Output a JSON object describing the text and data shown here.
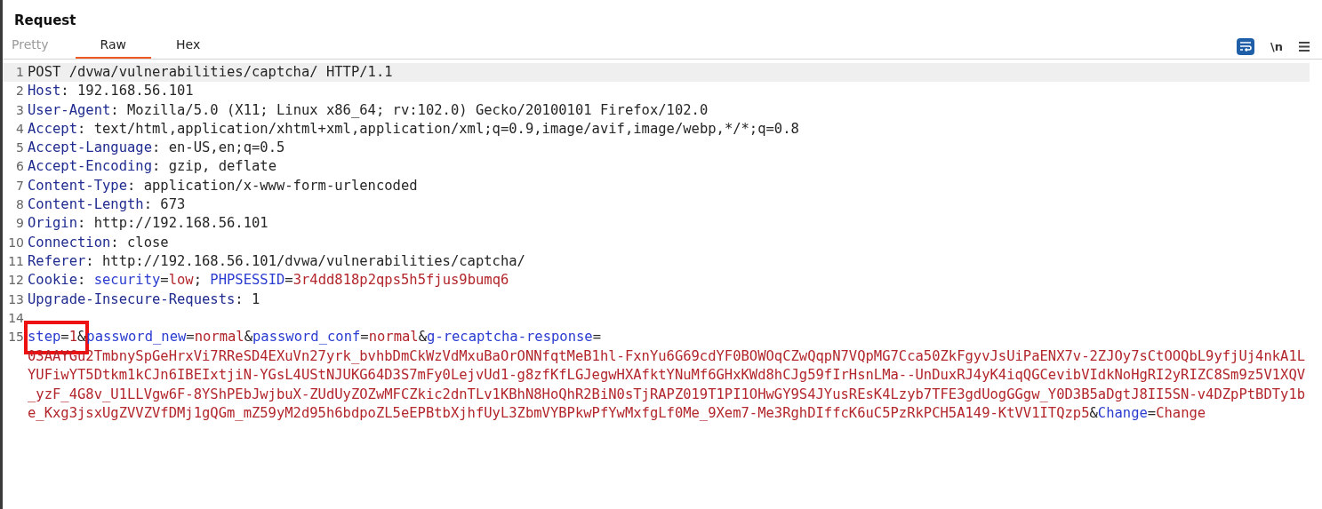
{
  "panel": {
    "title": "Request"
  },
  "tabs": [
    {
      "label": "Pretty",
      "selected": false,
      "disabled": true
    },
    {
      "label": "Raw",
      "selected": true,
      "disabled": false
    },
    {
      "label": "Hex",
      "selected": false,
      "disabled": false
    }
  ],
  "toolbar": {
    "wrap_lines": {
      "on": true
    },
    "newline_toggle": {
      "label": "\\n",
      "on": false
    }
  },
  "editor": {
    "lines": [
      {
        "number": "1",
        "current": true,
        "segments": [
          {
            "kind": "text",
            "text": "POST /dvwa/vulnerabilities/captcha/ HTTP/1.1"
          }
        ]
      },
      {
        "number": "2",
        "current": false,
        "segments": [
          {
            "kind": "header",
            "text": "Host"
          },
          {
            "kind": "text",
            "text": ": 192.168.56.101"
          }
        ]
      },
      {
        "number": "3",
        "current": false,
        "segments": [
          {
            "kind": "header",
            "text": "User-Agent"
          },
          {
            "kind": "text",
            "text": ": Mozilla/5.0 (X11; Linux x86_64; rv:102.0) Gecko/20100101 Firefox/102.0"
          }
        ]
      },
      {
        "number": "4",
        "current": false,
        "segments": [
          {
            "kind": "header",
            "text": "Accept"
          },
          {
            "kind": "text",
            "text": ": text/html,application/xhtml+xml,application/xml;q=0.9,image/avif,image/webp,*/*;q=0.8"
          }
        ]
      },
      {
        "number": "5",
        "current": false,
        "segments": [
          {
            "kind": "header",
            "text": "Accept-Language"
          },
          {
            "kind": "text",
            "text": ": en-US,en;q=0.5"
          }
        ]
      },
      {
        "number": "6",
        "current": false,
        "segments": [
          {
            "kind": "header",
            "text": "Accept-Encoding"
          },
          {
            "kind": "text",
            "text": ": gzip, deflate"
          }
        ]
      },
      {
        "number": "7",
        "current": false,
        "segments": [
          {
            "kind": "header",
            "text": "Content-Type"
          },
          {
            "kind": "text",
            "text": ": application/x-www-form-urlencoded"
          }
        ]
      },
      {
        "number": "8",
        "current": false,
        "segments": [
          {
            "kind": "header",
            "text": "Content-Length"
          },
          {
            "kind": "text",
            "text": ": 673"
          }
        ]
      },
      {
        "number": "9",
        "current": false,
        "segments": [
          {
            "kind": "header",
            "text": "Origin"
          },
          {
            "kind": "text",
            "text": ": http://192.168.56.101"
          }
        ]
      },
      {
        "number": "10",
        "current": false,
        "segments": [
          {
            "kind": "header",
            "text": "Connection"
          },
          {
            "kind": "text",
            "text": ": close"
          }
        ]
      },
      {
        "number": "11",
        "current": false,
        "segments": [
          {
            "kind": "header",
            "text": "Referer"
          },
          {
            "kind": "text",
            "text": ": http://192.168.56.101/dvwa/vulnerabilities/captcha/"
          }
        ]
      },
      {
        "number": "12",
        "current": false,
        "segments": [
          {
            "kind": "header",
            "text": "Cookie"
          },
          {
            "kind": "text",
            "text": ": "
          },
          {
            "kind": "param",
            "text": "security"
          },
          {
            "kind": "text",
            "text": "="
          },
          {
            "kind": "value",
            "text": "low"
          },
          {
            "kind": "text",
            "text": "; "
          },
          {
            "kind": "param",
            "text": "PHPSESSID"
          },
          {
            "kind": "text",
            "text": "="
          },
          {
            "kind": "value",
            "text": "3r4dd818p2qps5h5fjus9bumq6"
          }
        ]
      },
      {
        "number": "13",
        "current": false,
        "segments": [
          {
            "kind": "header",
            "text": "Upgrade-Insecure-Requests"
          },
          {
            "kind": "text",
            "text": ": 1"
          }
        ]
      },
      {
        "number": "14",
        "current": false
      },
      {
        "number": "15",
        "current": false,
        "segments": [
          {
            "kind": "param",
            "text": "step",
            "boxed": true
          },
          {
            "kind": "text",
            "text": "=",
            "boxed": true
          },
          {
            "kind": "value",
            "text": "1",
            "boxed": true
          },
          {
            "kind": "text",
            "text": "&",
            "boxed": true
          },
          {
            "kind": "param",
            "text": "password_new"
          },
          {
            "kind": "text",
            "text": "="
          },
          {
            "kind": "value",
            "text": "normal"
          },
          {
            "kind": "text",
            "text": "&"
          },
          {
            "kind": "param",
            "text": "password_conf"
          },
          {
            "kind": "text",
            "text": "="
          },
          {
            "kind": "value",
            "text": "normal"
          },
          {
            "kind": "text",
            "text": "&"
          },
          {
            "kind": "param",
            "text": "g-recaptcha-response"
          },
          {
            "kind": "text",
            "text": "="
          },
          {
            "kind": "value",
            "wrapped_lines": [
              "03AAYGu2TmbnySpGeHrxVi7RReSD4EXuVn27yrk_bvhbDmCkWzVdMxuBaOrONNfqtMeB1hl-FxnYu6G69cdYF0BOWOqCZwQqpN7VQpMG7Cca50ZkFgyvJsUiPaENX7v-2ZJOy7sCtOOQbL9yfjUj4nkA1L",
              "YUFiwYT5Dtkm1kCJn6IBEIxtjiN-YGsL4UStNJUKG64D3S7mFy0LejvUd1-g8zfKfLGJegwHXAfktYNuMf6GHxKWd8hCJg59fIrHsnLMa--UnDuxRJ4yK4iqQGCevibVIdkNoHgRI2yRIZC8Sm9z5V1XQV",
              "_yzF_4G8v_U1LLVgw6F-8YShPEbJwjbuX-ZUdUyZOZwMFCZkic2dnTLv1KBhN8HoQhR2BiN0sTjRAPZ019T1PI1OHwGY9S4JYusREsK4Lzyb7TFE3gdUogGGgw_Y0D3B5aDgtJ8II5SN-v4DZpPtBDTy1b",
              "e_Kxg3jsxUgZVVZVfDMj1gQGm_mZ59yM2d95h6bdpoZL5eEPBtbXjhfUyL3ZbmVYBPkwPfYwMxfgLf0Me_9Xem7-Me3RghDIffcK6uC5PzRkPCH5A149-KtVV1ITQzp5"
            ]
          },
          {
            "kind": "text",
            "text": "&"
          },
          {
            "kind": "param",
            "text": "Change"
          },
          {
            "kind": "text",
            "text": "="
          },
          {
            "kind": "value",
            "text": "Change"
          }
        ]
      }
    ]
  }
}
